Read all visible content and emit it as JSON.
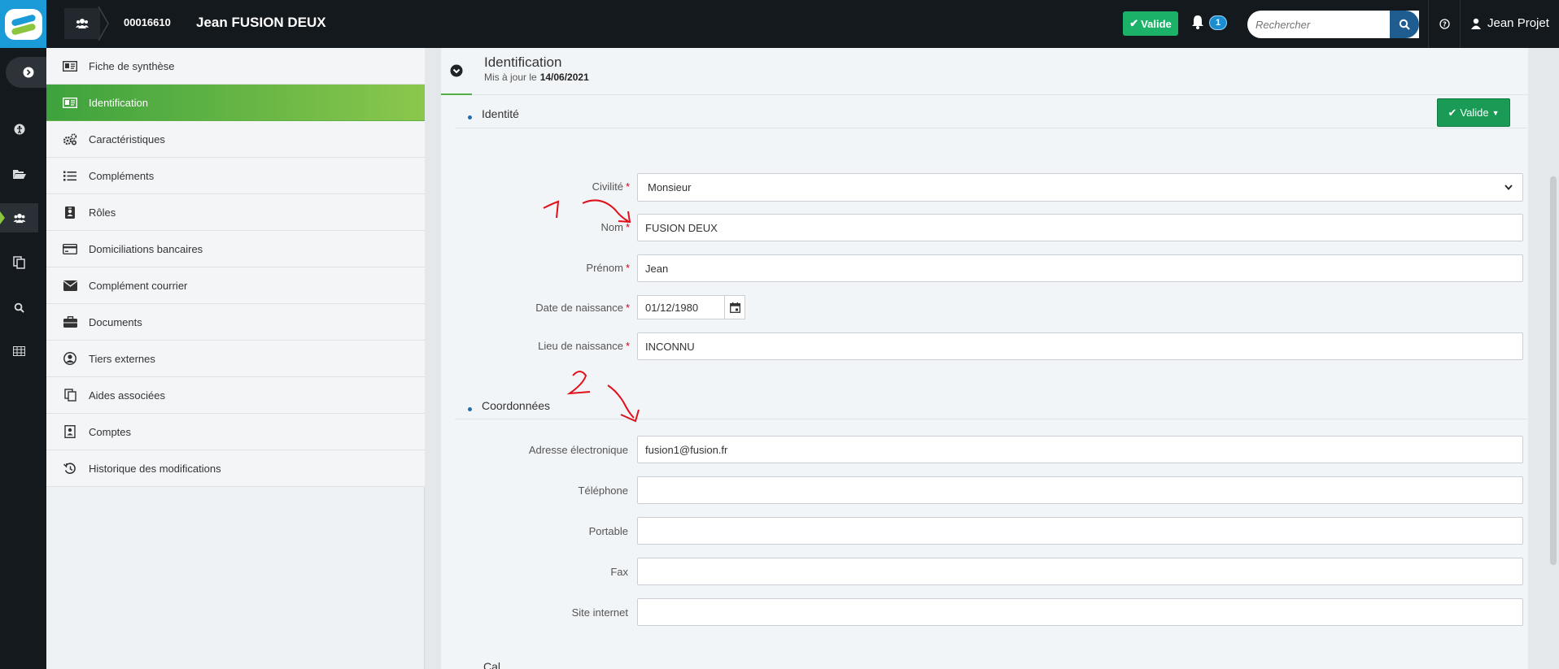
{
  "header": {
    "dossier_number": "00016610",
    "dossier_name": "Jean FUSION DEUX",
    "status_label": "Valide",
    "notification_count": "1",
    "search_placeholder": "Rechercher",
    "user_name": "Jean Projet"
  },
  "rail": {
    "icons": [
      "chevron-right-icon",
      "accessibility-icon",
      "folder-open-icon",
      "users-icon",
      "copy-icon",
      "search-icon",
      "table-icon"
    ],
    "active": "users-icon"
  },
  "sidebar": {
    "items": [
      {
        "label": "Fiche de synthèse",
        "icon": "id-card-icon"
      },
      {
        "label": "Identification",
        "icon": "id-card-icon",
        "active": true
      },
      {
        "label": "Caractéristiques",
        "icon": "cogs-icon"
      },
      {
        "label": "Compléments",
        "icon": "list-icon"
      },
      {
        "label": "Rôles",
        "icon": "id-badge-icon"
      },
      {
        "label": "Domiciliations bancaires",
        "icon": "credit-card-icon"
      },
      {
        "label": "Complément courrier",
        "icon": "envelope-icon"
      },
      {
        "label": "Documents",
        "icon": "briefcase-icon"
      },
      {
        "label": "Tiers externes",
        "icon": "user-circle-icon"
      },
      {
        "label": "Aides associées",
        "icon": "copy-icon"
      },
      {
        "label": "Comptes",
        "icon": "address-card-icon"
      },
      {
        "label": "Historique des modifications",
        "icon": "history-icon"
      }
    ]
  },
  "panel": {
    "title": "Identification",
    "updated_label": "Mis à jour le",
    "updated_date": "14/06/2021",
    "status_button": "Valide",
    "identity_section": "Identité",
    "contact_section": "Coordonnées",
    "next_section_partial": "Cal..."
  },
  "identity": {
    "civilite_label": "Civilité",
    "civilite_value": "Monsieur",
    "nom_label": "Nom",
    "nom_value": "FUSION DEUX",
    "prenom_label": "Prénom",
    "prenom_value": "Jean",
    "naissance_label": "Date de naissance",
    "naissance_value": "01/12/1980",
    "lieu_label": "Lieu de naissance",
    "lieu_value": "INCONNU"
  },
  "contact": {
    "email_label": "Adresse électronique",
    "email_value": "fusion1@fusion.fr",
    "phone_label": "Téléphone",
    "phone_value": "",
    "mobile_label": "Portable",
    "mobile_value": "",
    "fax_label": "Fax",
    "fax_value": "",
    "website_label": "Site internet",
    "website_value": ""
  },
  "annotations": {
    "mark_1": "1",
    "mark_2": "2"
  },
  "colors": {
    "accent_green": "#199a55",
    "active_nav_start": "#3da23d",
    "active_nav_end": "#8bc74c",
    "topbar": "#14191d",
    "required": "#d0021b",
    "annotation_red": "#e0101a"
  }
}
